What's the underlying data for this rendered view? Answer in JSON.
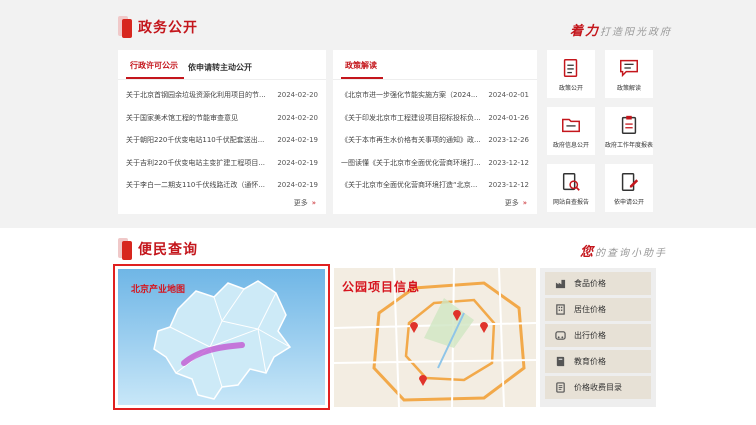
{
  "gov_affairs": {
    "title": "政务公开",
    "slogan_big": "着力",
    "slogan_rest": "打造阳光政府",
    "left_panel": {
      "tabs": [
        "行政许可公示",
        "依申请转主动公开"
      ],
      "items": [
        {
          "text": "关于北京首钢园余垃圾资源化利用项目的节...",
          "date": "2024-02-20"
        },
        {
          "text": "关于国家美术馆工程的节能审查意见",
          "date": "2024-02-20"
        },
        {
          "text": "关于朝阳220千伏变电站110千伏配套送出...",
          "date": "2024-02-19"
        },
        {
          "text": "关于吉利220千伏变电站主变扩建工程项目...",
          "date": "2024-02-19"
        },
        {
          "text": "关于李白一二期支110千伏线路迁改（通怀...",
          "date": "2024-02-19"
        }
      ],
      "more": "更多"
    },
    "right_panel": {
      "tabs": [
        "政策解读"
      ],
      "items": [
        {
          "text": "《北京市进一步强化节能实施方案（2024...",
          "date": "2024-02-01"
        },
        {
          "text": "《关于印发北京市工程建设项目招标投标负...",
          "date": "2024-01-26"
        },
        {
          "text": "《关于本市再生水价格有关事项的通知》政...",
          "date": "2023-12-26"
        },
        {
          "text": "一图读懂《关于北京市全面优化营商环境打...",
          "date": "2023-12-12"
        },
        {
          "text": "《关于北京市全面优化营商环境打造“北京...",
          "date": "2023-12-12"
        }
      ],
      "more": "更多"
    },
    "quick_links": [
      {
        "label": "政策公开",
        "icon": "document-icon"
      },
      {
        "label": "政策解读",
        "icon": "chat-icon"
      },
      {
        "label": "政府信息公开",
        "icon": "folder-icon"
      },
      {
        "label": "政府工作年度报表",
        "icon": "clipboard-icon"
      },
      {
        "label": "网站自查报告",
        "icon": "search-document-icon"
      },
      {
        "label": "依申请公开",
        "icon": "edit-document-icon"
      }
    ]
  },
  "convenience": {
    "title": "便民查询",
    "slogan_big": "您",
    "slogan_rest": "的查询小助手",
    "map_card": {
      "title": "北京产业地图"
    },
    "park_card": {
      "title": "公园项目信息"
    },
    "price_items": [
      {
        "label": "食品价格",
        "icon": "factory-icon"
      },
      {
        "label": "居住价格",
        "icon": "building-icon"
      },
      {
        "label": "出行价格",
        "icon": "car-icon"
      },
      {
        "label": "教育价格",
        "icon": "book-icon"
      },
      {
        "label": "价格收费目录",
        "icon": "list-icon"
      }
    ]
  },
  "colors": {
    "brand_red": "#c4161c",
    "highlight_border": "#e02020"
  }
}
